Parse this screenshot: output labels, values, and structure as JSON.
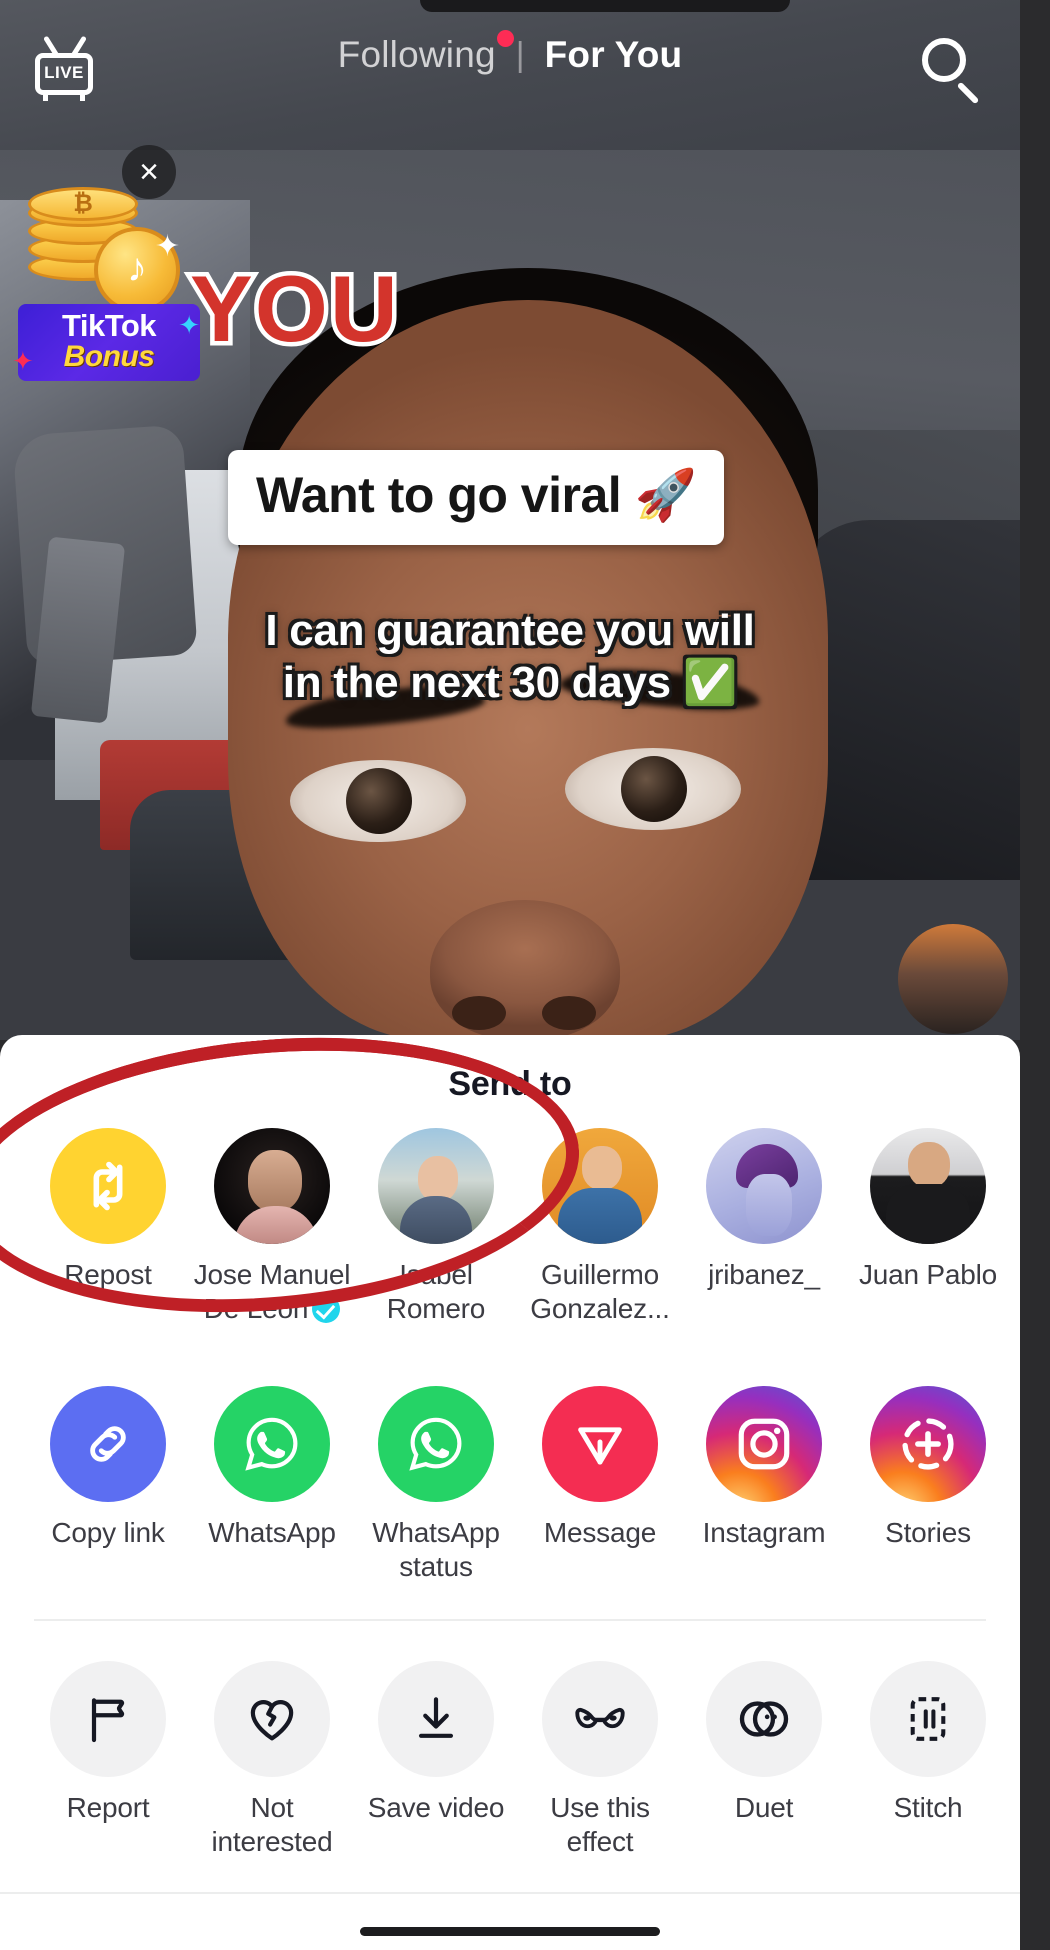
{
  "app": {
    "name": "TikTok"
  },
  "topnav": {
    "live_label": "LIVE",
    "tab_following": "Following",
    "separator": "|",
    "tab_foryou": "For You",
    "search_icon": "search-icon"
  },
  "promo": {
    "badge_line1": "TikTok",
    "badge_line2": "Bonus",
    "close_label": "×",
    "coin_symbol": "₿"
  },
  "video": {
    "overlay_headline": "YOU",
    "caption_box": "Want to go viral 🚀",
    "subtitle_line1": "I can guarantee you will",
    "subtitle_line2": "in the next 30 days ✅"
  },
  "sheet": {
    "title": "Send to",
    "contacts": [
      {
        "label": "Repost",
        "type": "repost",
        "verified": false
      },
      {
        "label": "Jose Manuel De León",
        "type": "avatar",
        "avatar": "a-jose",
        "verified": true
      },
      {
        "label": "Isabel Romero",
        "type": "avatar",
        "avatar": "a-isa",
        "verified": false
      },
      {
        "label": "Guillermo Gonzalez...",
        "type": "avatar",
        "avatar": "a-gui",
        "verified": false
      },
      {
        "label": "jribanez_",
        "type": "avatar",
        "avatar": "a-jri",
        "verified": false
      },
      {
        "label": "Juan Pablo",
        "type": "avatar",
        "avatar": "a-juan",
        "verified": false
      }
    ],
    "apps": [
      {
        "label": "Copy link",
        "icon": "link-icon",
        "color": "#5c6ef2"
      },
      {
        "label": "WhatsApp",
        "icon": "whatsapp-icon",
        "color": "#25d366"
      },
      {
        "label": "WhatsApp status",
        "icon": "whatsapp-icon",
        "color": "#25d366"
      },
      {
        "label": "Message",
        "icon": "send-arrow-icon",
        "color": "#f42d52"
      },
      {
        "label": "Instagram",
        "icon": "instagram-icon",
        "color": "#d62976"
      },
      {
        "label": "Stories",
        "icon": "stories-plus-icon",
        "color": "#962fbf"
      }
    ],
    "actions": [
      {
        "label": "Report",
        "icon": "flag-icon"
      },
      {
        "label": "Not interested",
        "icon": "broken-heart-icon"
      },
      {
        "label": "Save video",
        "icon": "download-icon"
      },
      {
        "label": "Use this effect",
        "icon": "mask-icon"
      },
      {
        "label": "Duet",
        "icon": "duet-circles-icon"
      },
      {
        "label": "Stitch",
        "icon": "stitch-frame-icon"
      }
    ]
  },
  "colors": {
    "accent_red": "#fe2c55",
    "repost_yellow": "#ffd330",
    "verified_blue": "#20d5ec",
    "annotation_red": "#bf2026",
    "sheet_bg": "#ffffff"
  }
}
